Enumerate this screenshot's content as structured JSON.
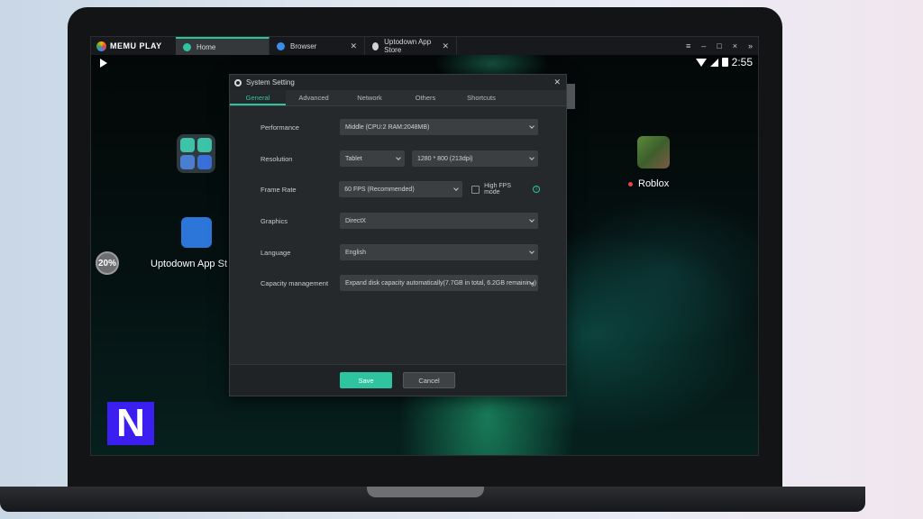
{
  "app": {
    "brand": "MEMU PLAY",
    "tabs": [
      {
        "label": "Home",
        "active": true
      },
      {
        "label": "Browser",
        "active": false
      },
      {
        "label": "Uptodown App Store",
        "active": false
      }
    ],
    "window_controls": [
      "≡",
      "–",
      "□",
      "×",
      "»"
    ]
  },
  "status_bar": {
    "time": "2:55"
  },
  "home_screen": {
    "apps": [
      {
        "label": "Uptodown App St",
        "icon": "uptodown-icon"
      },
      {
        "label": "Roblox",
        "icon": "roblox-icon"
      }
    ],
    "progress_badge": "20%",
    "corner_logo": "N"
  },
  "dialog": {
    "title": "System Setting",
    "tabs": [
      "General",
      "Advanced",
      "Network",
      "Others",
      "Shortcuts"
    ],
    "active_tab": "General",
    "rows": {
      "performance": {
        "label": "Performance",
        "value": "Middle (CPU:2 RAM:2048MB)"
      },
      "resolution": {
        "label": "Resolution",
        "mode": "Tablet",
        "value": "1280 * 800 (213dpi)"
      },
      "frame_rate": {
        "label": "Frame Rate",
        "value": "60 FPS (Recommended)",
        "high_fps_label": "High FPS mode"
      },
      "graphics": {
        "label": "Graphics",
        "value": "DirectX"
      },
      "language": {
        "label": "Language",
        "value": "English"
      },
      "capacity": {
        "label": "Capacity management",
        "value": "Expand disk capacity automatically(7.7GB in total, 6.2GB remaining)"
      }
    },
    "buttons": {
      "save": "Save",
      "cancel": "Cancel"
    }
  },
  "colors": {
    "accent": "#2ec4a0",
    "dialog_bg": "#26292c",
    "titlebar_bg": "#17191c"
  }
}
